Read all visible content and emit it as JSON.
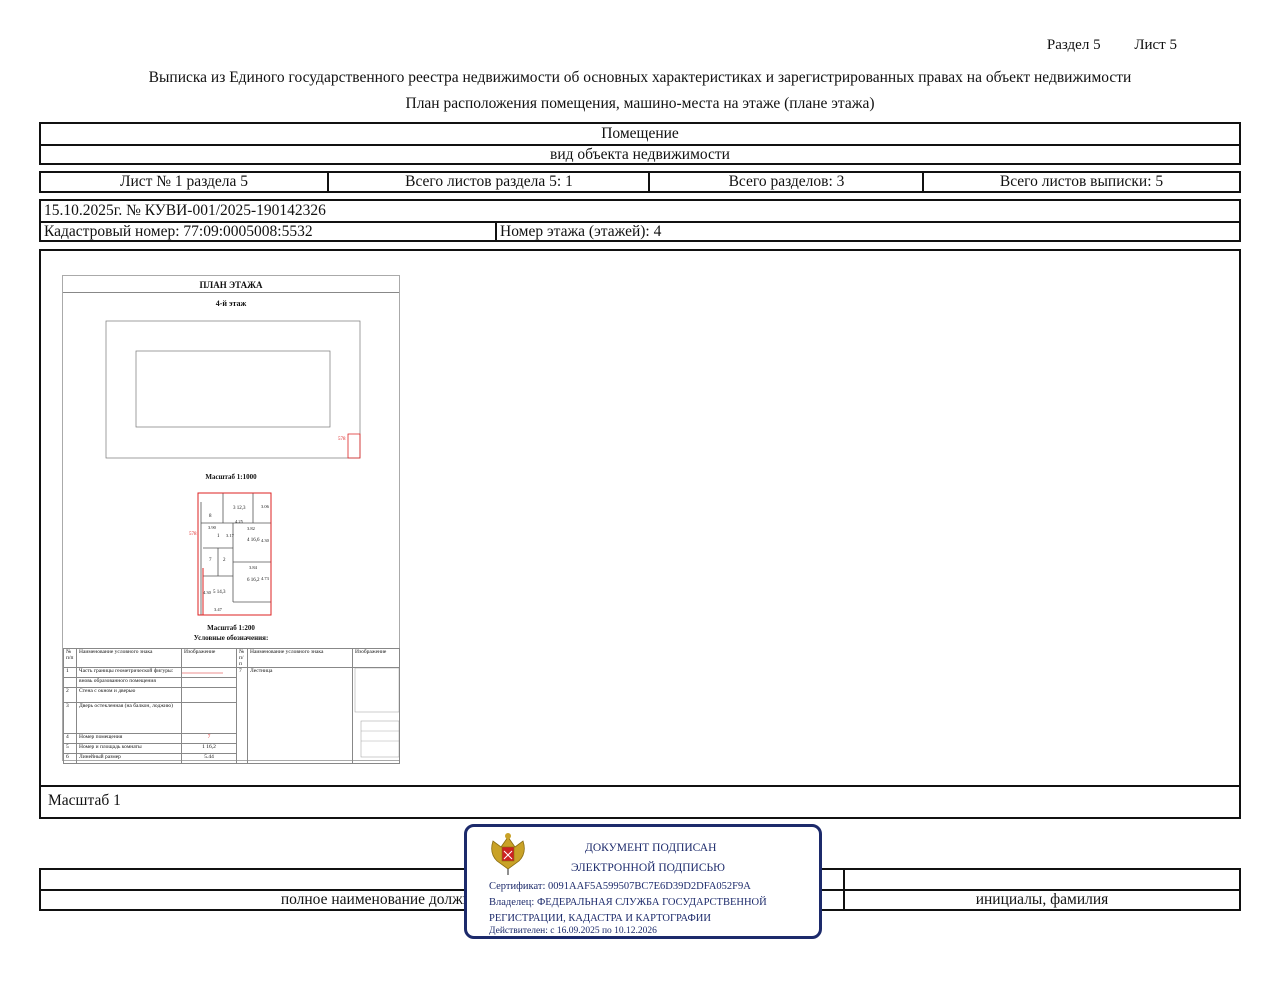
{
  "header": {
    "section": "Раздел 5",
    "sheet": "Лист 5",
    "title": "Выписка из Единого государственного реестра недвижимости об основных характеристиках и зарегистрированных правах на объект недвижимости",
    "subtitle": "План расположения помещения, машино-места на этаже (плане этажа)"
  },
  "object": {
    "name": "Помещение",
    "type_caption": "вид объекта недвижимости"
  },
  "sheets": {
    "sheet_of_section": "Лист № 1 раздела 5",
    "total_sheets_section": "Всего листов раздела 5: 1",
    "total_sections": "Всего разделов: 3",
    "total_sheets": "Всего листов выписки: 5"
  },
  "record": {
    "date_number": "15.10.2025г. № КУВИ-001/2025-190142326",
    "cadastral": "Кадастровый номер: 77:09:0005008:5532",
    "floor": "Номер этажа (этажей): 4"
  },
  "plan": {
    "title": "ПЛАН ЭТАЖА",
    "floor": "4-й этаж",
    "scale1": "Масштаб 1:1000",
    "scale2": "Масштаб 1:200",
    "legend_title": "Условные обозначения:",
    "room_label": "578",
    "small_label": "578",
    "rooms": [
      {
        "n": "3",
        "a": "12,3"
      },
      {
        "n": "8",
        "a": ""
      },
      {
        "n": "1",
        "a": ""
      },
      {
        "n": "4",
        "a": "16,6"
      },
      {
        "n": "7",
        "a": ""
      },
      {
        "n": "2",
        "a": ""
      },
      {
        "n": "6",
        "a": "16,2"
      },
      {
        "n": "5",
        "a": "14,3"
      }
    ],
    "dims": [
      "3.90",
      "4.25",
      "3.82",
      "3.17",
      "4.30",
      "3.84",
      "4.73",
      "4.30",
      "3.47",
      "3.06"
    ],
    "legend_headers": [
      "№ п/п",
      "Наименование условного знака",
      "Изображение",
      "№ п/п",
      "Наименование условного знака",
      "Изображение"
    ],
    "legend_rows": [
      {
        "n": "1",
        "name": "Часть границы геометрической фигуры:"
      },
      {
        "n": "",
        "name": "вновь образованного помещения"
      },
      {
        "n": "2",
        "name": "Стена с окном и дверью"
      },
      {
        "n": "3",
        "name": "Дверь остекленная (на балкон, лоджию)"
      },
      {
        "n": "4",
        "name": "Номер помещения"
      },
      {
        "n": "5",
        "name": "Номер и площадь комнаты"
      },
      {
        "n": "6",
        "name": "Линейный размер"
      }
    ],
    "legend_right": {
      "n": "7",
      "name": "Лестница"
    },
    "legend_samples": {
      "room": "7",
      "area_n": "1",
      "area_v": "16,2",
      "dim": "5.44"
    }
  },
  "scale": "Масштаб 1",
  "footer": {
    "position": "полное наименование должности",
    "initials": "инициалы, фамилия"
  },
  "stamp": {
    "line1": "ДОКУМЕНТ ПОДПИСАН",
    "line2": "ЭЛЕКТРОННОЙ ПОДПИСЬЮ",
    "cert": "Сертификат: 0091AAF5A599507BC7E6D39D2DFA052F9A",
    "owner1": "Владелец: ФЕДЕРАЛЬНАЯ СЛУЖБА ГОСУДАРСТВЕННОЙ",
    "owner2": "РЕГИСТРАЦИИ, КАДАСТРА И КАРТОГРАФИИ",
    "valid": "Действителен: с 16.09.2025 по 10.12.2026",
    "color": "#1c2a6b"
  }
}
